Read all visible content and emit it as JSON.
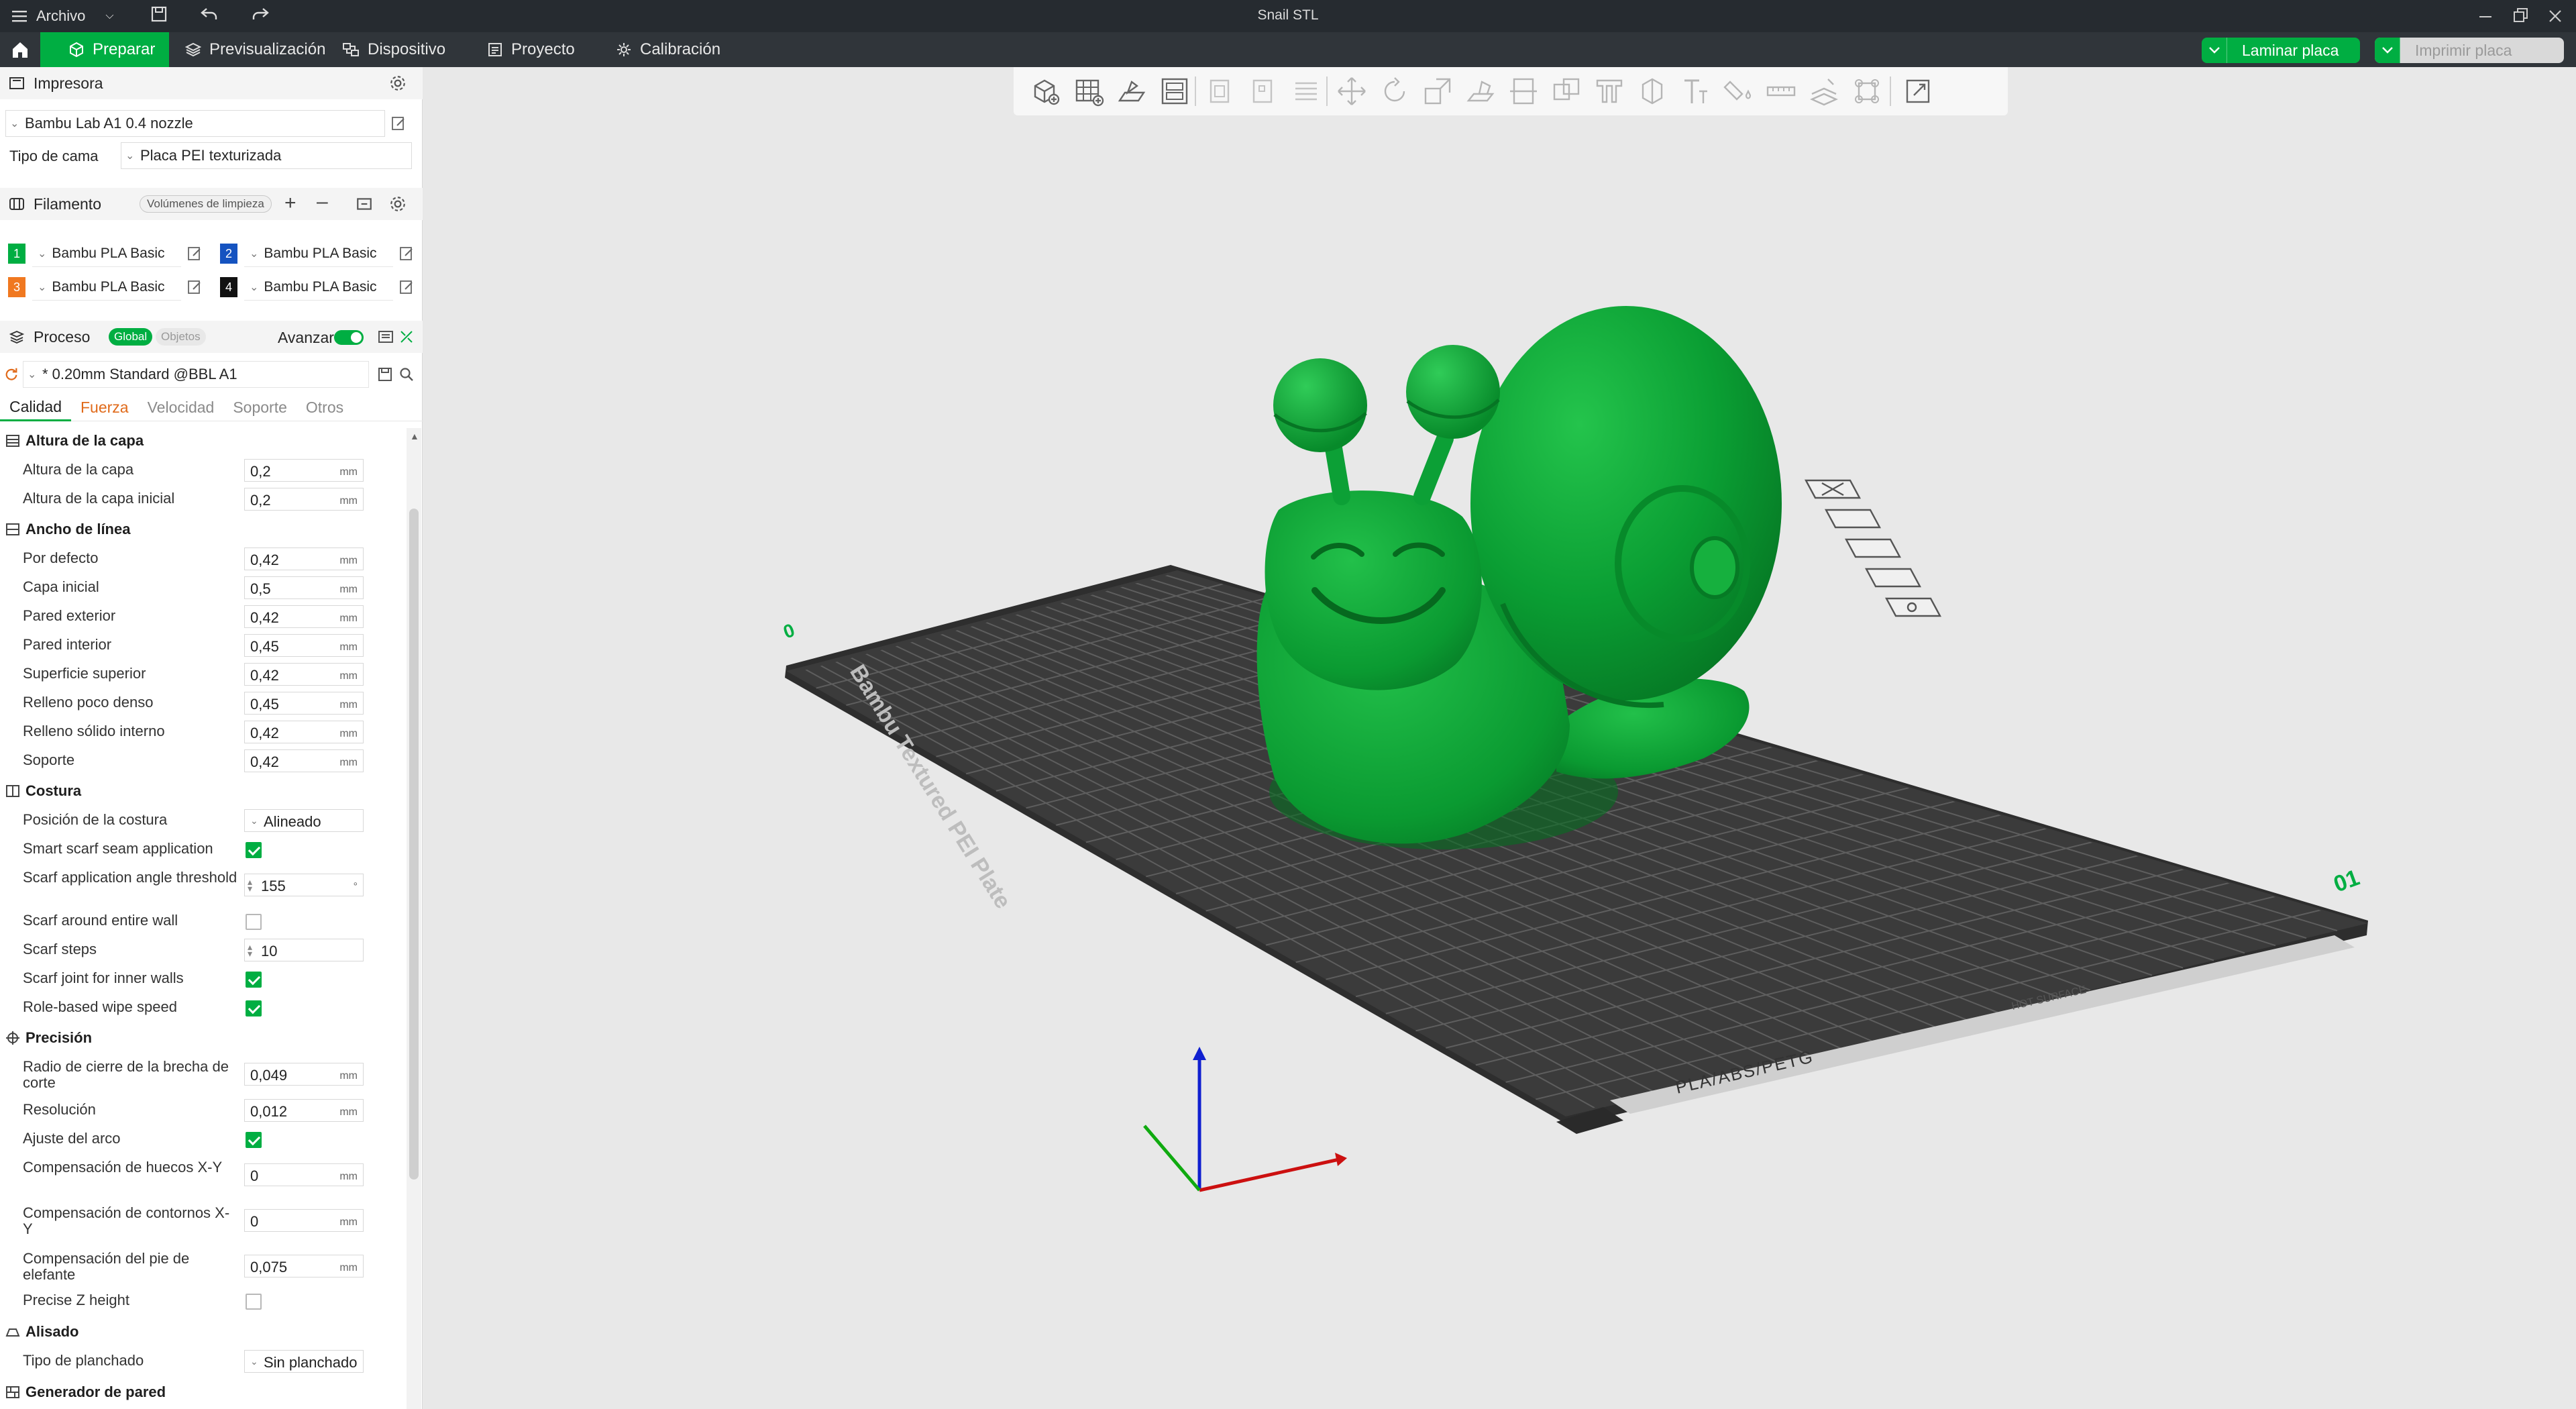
{
  "window": {
    "title": "Snail STL",
    "file_menu": "Archivo"
  },
  "tabs": {
    "prepare": "Preparar",
    "preview": "Previsualización",
    "device": "Dispositivo",
    "project": "Proyecto",
    "calibration": "Calibración"
  },
  "actions": {
    "slice": "Laminar placa",
    "print": "Imprimir placa"
  },
  "printer": {
    "section": "Impresora",
    "name": "Bambu Lab A1 0.4 nozzle",
    "bed_label": "Tipo de cama",
    "bed_value": "Placa PEI texturizada"
  },
  "filament": {
    "section": "Filamento",
    "flush_button": "Volúmenes de limpieza",
    "slots": [
      {
        "num": "1",
        "name": "Bambu PLA Basic",
        "color": "#00ae42"
      },
      {
        "num": "2",
        "name": "Bambu PLA Basic",
        "color": "#1553c0"
      },
      {
        "num": "3",
        "name": "Bambu PLA Basic",
        "color": "#f07820"
      },
      {
        "num": "4",
        "name": "Bambu PLA Basic",
        "color": "#111111"
      }
    ]
  },
  "process": {
    "section": "Proceso",
    "global": "Global",
    "objects": "Objetos",
    "advanced": "Avanzar",
    "preset": "* 0.20mm Standard @BBL A1"
  },
  "subtabs": [
    "Calidad",
    "Fuerza",
    "Velocidad",
    "Soporte",
    "Otros"
  ],
  "groups": {
    "layer_height": "Altura de la capa",
    "line_width": "Ancho de línea",
    "seam": "Costura",
    "precision": "Precisión",
    "ironing": "Alisado",
    "wall_generator": "Generador de pared"
  },
  "params": {
    "layer_height": {
      "label": "Altura de la capa",
      "value": "0,2",
      "unit": "mm"
    },
    "initial_layer_height": {
      "label": "Altura de la capa inicial",
      "value": "0,2",
      "unit": "mm"
    },
    "lw_default": {
      "label": "Por defecto",
      "value": "0,42",
      "unit": "mm"
    },
    "lw_initial": {
      "label": "Capa inicial",
      "value": "0,5",
      "unit": "mm"
    },
    "lw_outer": {
      "label": "Pared exterior",
      "value": "0,42",
      "unit": "mm"
    },
    "lw_inner": {
      "label": "Pared interior",
      "value": "0,45",
      "unit": "mm"
    },
    "lw_top": {
      "label": "Superficie superior",
      "value": "0,42",
      "unit": "mm"
    },
    "lw_sparse": {
      "label": "Relleno poco denso",
      "value": "0,45",
      "unit": "mm"
    },
    "lw_solid": {
      "label": "Relleno sólido interno",
      "value": "0,42",
      "unit": "mm"
    },
    "lw_support": {
      "label": "Soporte",
      "value": "0,42",
      "unit": "mm"
    },
    "seam_pos": {
      "label": "Posición de la costura",
      "value": "Alineado"
    },
    "scarf_smart": {
      "label": "Smart scarf seam application",
      "checked": true
    },
    "scarf_angle": {
      "label": "Scarf application angle threshold",
      "value": "155",
      "unit": "°"
    },
    "scarf_entire": {
      "label": "Scarf around entire wall",
      "checked": false
    },
    "scarf_steps": {
      "label": "Scarf steps",
      "value": "10"
    },
    "scarf_inner": {
      "label": "Scarf joint for inner walls",
      "checked": true
    },
    "role_wipe": {
      "label": "Role-based wipe speed",
      "checked": true
    },
    "gap_radius": {
      "label": "Radio de cierre de la brecha de corte",
      "value": "0,049",
      "unit": "mm"
    },
    "resolution": {
      "label": "Resolución",
      "value": "0,012",
      "unit": "mm"
    },
    "arc_fit": {
      "label": "Ajuste del arco",
      "checked": true
    },
    "xy_hole": {
      "label": "Compensación de huecos X-Y",
      "value": "0",
      "unit": "mm"
    },
    "xy_contour": {
      "label": "Compensación de contornos X-Y",
      "value": "0",
      "unit": "mm"
    },
    "elephant": {
      "label": "Compensación del pie de elefante",
      "value": "0,075",
      "unit": "mm"
    },
    "precise_z": {
      "label": "Precise Z height",
      "checked": false
    },
    "ironing_type": {
      "label": "Tipo de planchado",
      "value": "Sin planchado"
    }
  },
  "plate": {
    "name": "Bambu Textured PEI Plate",
    "materials": "PLA/ABS/PETG",
    "hot_surface": "HOT SURFACE",
    "plate_number": "01"
  },
  "colors": {
    "accent": "#00ae42",
    "model": "#0a9a33",
    "bed": "#3b3b3b",
    "grid": "#5c5c5c"
  }
}
